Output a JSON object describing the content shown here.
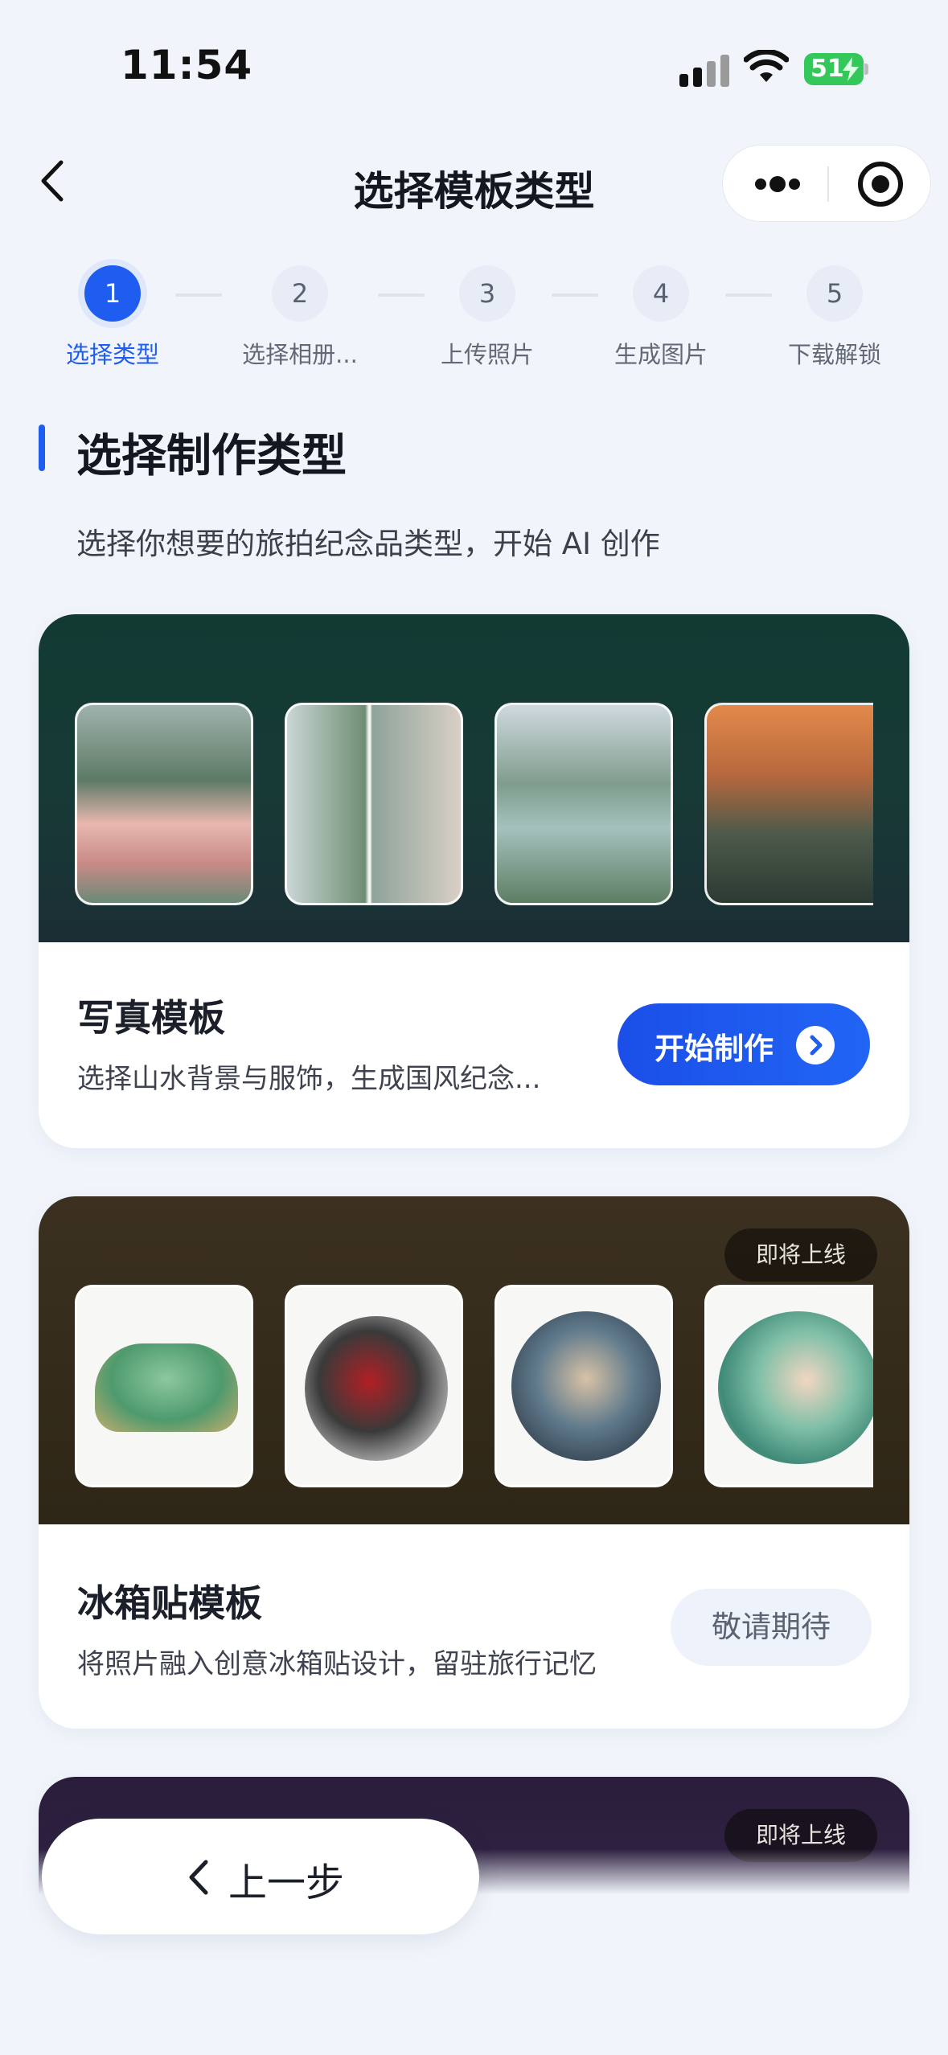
{
  "status_bar": {
    "time": "11:54",
    "battery": "51"
  },
  "header": {
    "title": "选择模板类型"
  },
  "stepper": [
    {
      "num": "1",
      "label": "选择类型",
      "active": true
    },
    {
      "num": "2",
      "label": "选择相册...",
      "active": false
    },
    {
      "num": "3",
      "label": "上传照片",
      "active": false
    },
    {
      "num": "4",
      "label": "生成图片",
      "active": false
    },
    {
      "num": "5",
      "label": "下载解锁",
      "active": false
    }
  ],
  "section": {
    "title": "选择制作类型",
    "desc": "选择你想要的旅拍纪念品类型，开始 AI 创作"
  },
  "cards": [
    {
      "title": "写真模板",
      "desc": "选择山水背景与服饰，生成国风纪念...",
      "button": "开始制作"
    },
    {
      "title": "冰箱贴模板",
      "desc": "将照片融入创意冰箱贴设计，留驻旅行记忆",
      "badge": "即将上线",
      "button": "敬请期待"
    },
    {
      "badge": "即将上线"
    }
  ],
  "footer": {
    "prev_label": "上一步"
  },
  "colors": {
    "accent": "#1f5cf0",
    "page_bg": "#f1f5fb"
  }
}
